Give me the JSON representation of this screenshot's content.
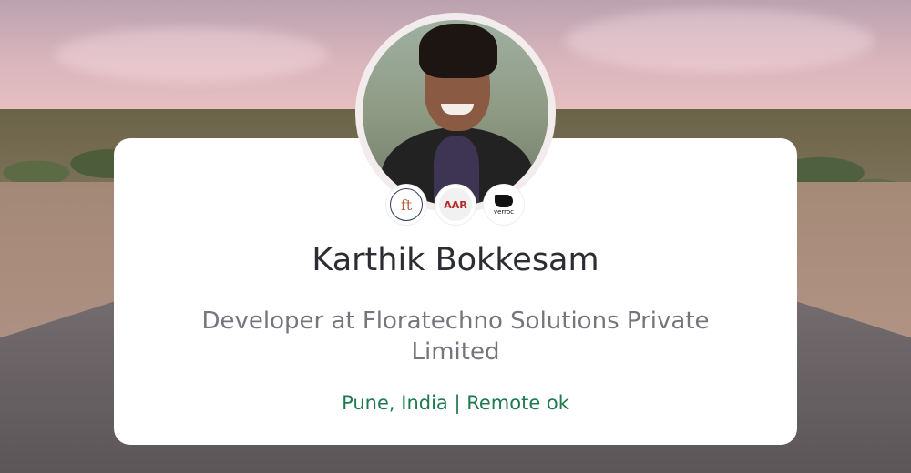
{
  "profile": {
    "name": "Karthik Bokkesam",
    "headline": "Developer at Floratechno Solutions Private Limited",
    "location": "Pune, India | Remote ok"
  },
  "company_logos": [
    {
      "text": "ft",
      "icon": "floratechno-logo"
    },
    {
      "text": "AAR",
      "icon": "company-logo-aar"
    },
    {
      "text": "verroc",
      "icon": "company-logo-verroc"
    }
  ],
  "colors": {
    "name": "#2b2d33",
    "headline": "#76757e",
    "location": "#1f7a50",
    "card": "#ffffff"
  }
}
